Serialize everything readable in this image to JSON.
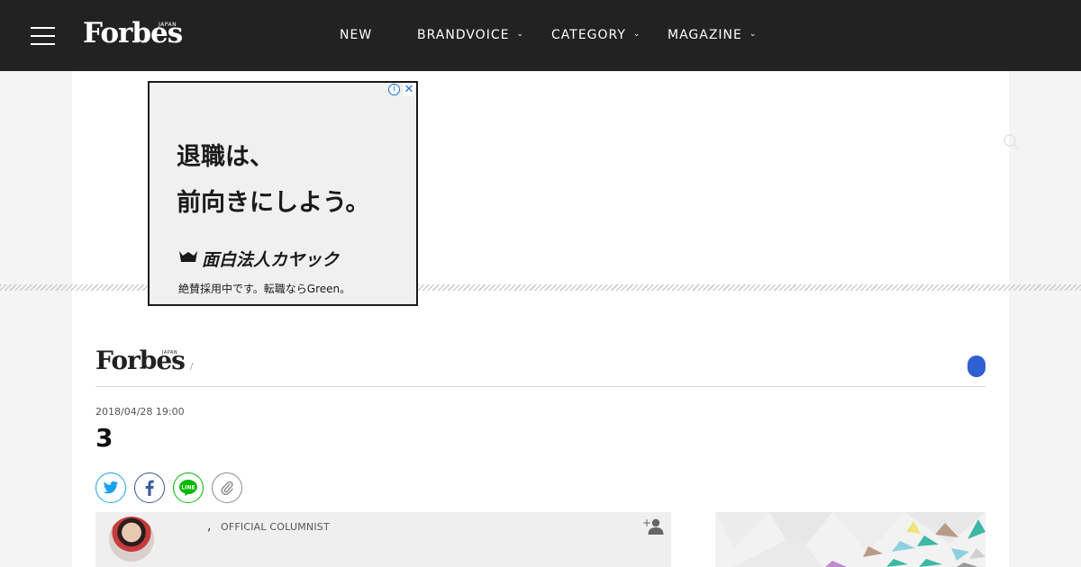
{
  "header": {
    "logo": "Forbes",
    "logo_sup": "JAPAN",
    "nav": [
      {
        "label": "NEW",
        "has_dropdown": false
      },
      {
        "label": "BRANDVOICE",
        "has_dropdown": true
      },
      {
        "label": "CATEGORY",
        "has_dropdown": true
      },
      {
        "label": "MAGAZINE",
        "has_dropdown": true
      }
    ]
  },
  "ad": {
    "line1": "退職は、",
    "line2": "前向きにしよう。",
    "brand": "面白法人カヤック",
    "tagline": "絶賛採用中です。転職ならGreen。",
    "info_glyph": "i",
    "close_glyph": "✕"
  },
  "article": {
    "logo": "Forbes",
    "logo_sup": "JAPAN",
    "crumb_sep": "/",
    "date": "2018/04/28 19:00",
    "title": "3"
  },
  "share": [
    "twitter-icon",
    "facebook-icon",
    "line-icon",
    "link-icon"
  ],
  "author": {
    "name_sep": ",",
    "role": "OFFICIAL COLUMNIST"
  },
  "colors": {
    "topbar": "#222222",
    "accent_blue": "#2f5fd0",
    "twitter": "#1da1f2",
    "facebook": "#3b5998",
    "line": "#00b900",
    "link": "#8a8a8a"
  }
}
